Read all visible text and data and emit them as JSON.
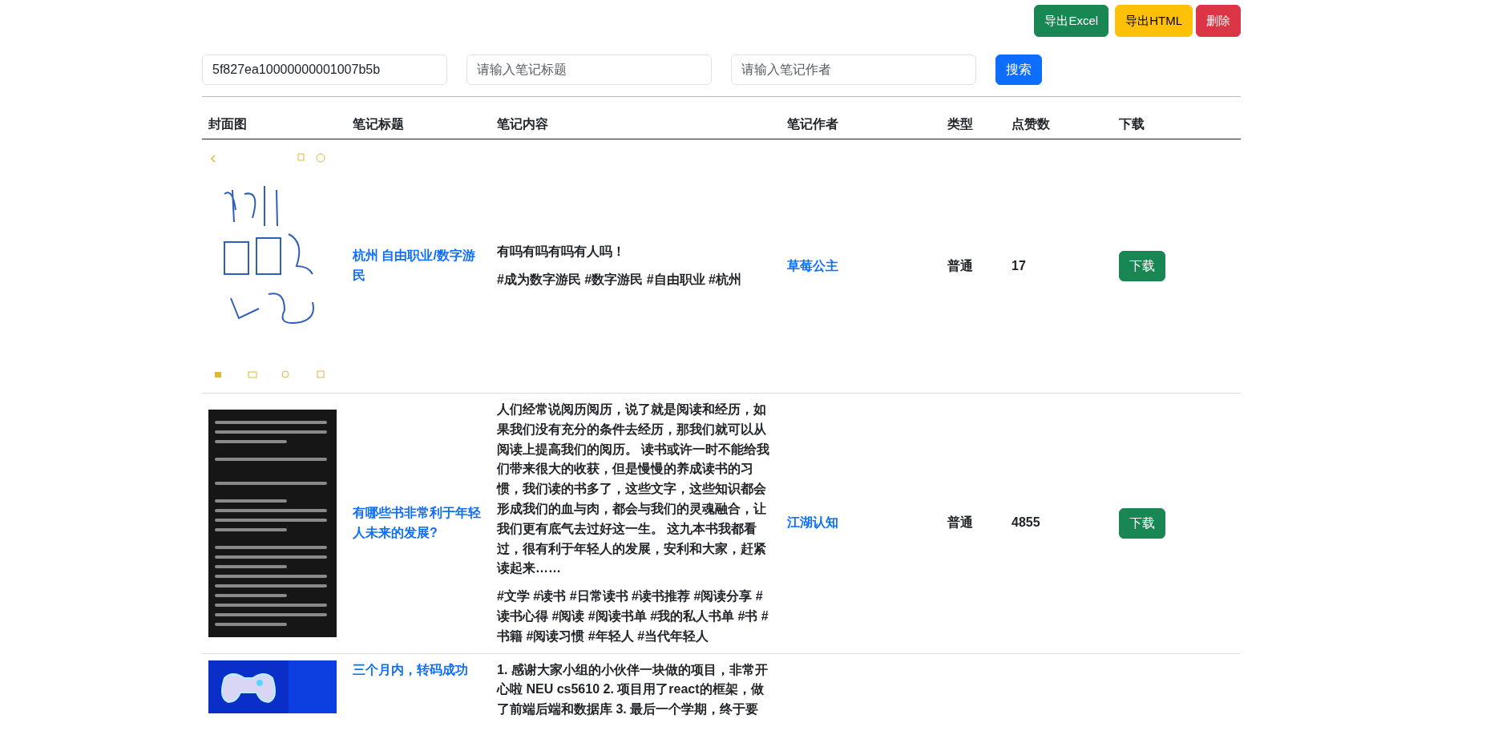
{
  "toolbar": {
    "buttons": [
      {
        "label": "导出Excel",
        "kind": "success"
      },
      {
        "label": "导出HTML",
        "kind": "warning"
      },
      {
        "label": "删除",
        "kind": "danger"
      }
    ]
  },
  "search": {
    "fields": [
      {
        "value": "5f827ea10000000001007b5b"
      },
      {
        "placeholder": "请输入笔记标题"
      },
      {
        "placeholder": "请输入笔记作者"
      }
    ],
    "button": "搜索"
  },
  "table": {
    "columns": [
      "封面图",
      "笔记标题",
      "笔记内容",
      "笔记作者",
      "类型",
      "点赞数",
      "下载"
    ],
    "rows": [
      {
        "cover": {
          "kind": "picture"
        },
        "title": "杭州 自由职业/数字游民",
        "content": [
          "有吗有吗有吗有人吗！",
          "#成为数字游民 #数字游民 #自由职业 #杭州"
        ],
        "author": "草莓公主",
        "type": "普通",
        "likes": "17",
        "download": "下载"
      },
      {
        "cover": {
          "kind": "picture"
        },
        "title": "有哪些书非常利于年轻人未来的发展?",
        "content": [
          "人们经常说阅历阅历，说了就是阅读和经历，如果我们没有充分的条件去经历，那我们就可以从阅读上提高我们的阅历。 读书或许一时不能给我们带来很大的收获，但是慢慢的养成读书的习惯，我们读的书多了，这些文字，这些知识都会形成我们的血与肉，都会与我们的灵魂融合，让我们更有底气去过好这一生。 这九本书我都看过，很有利于年轻人的发展，安利和大家，赶紧读起来……",
          "#文学 #读书 #日常读书 #读书推荐 #阅读分享 #读书心得 #阅读 #阅读书单 #我的私人书单 #书 #书籍 #阅读习惯 #年轻人 #当代年轻人"
        ],
        "author": "江湖认知",
        "type": "普通",
        "likes": "4855",
        "download": "下载"
      },
      {
        "cover": {
          "kind": "picture"
        },
        "title": "三个月内，转码成功",
        "content": [
          "1. 感谢大家小组的小伙伴一块做的项目，非常开心啦 NEU cs5610 2. 项目用了react的框架，做了前端后端和数据库 3. 最后一个学期，终于要"
        ]
      }
    ]
  }
}
